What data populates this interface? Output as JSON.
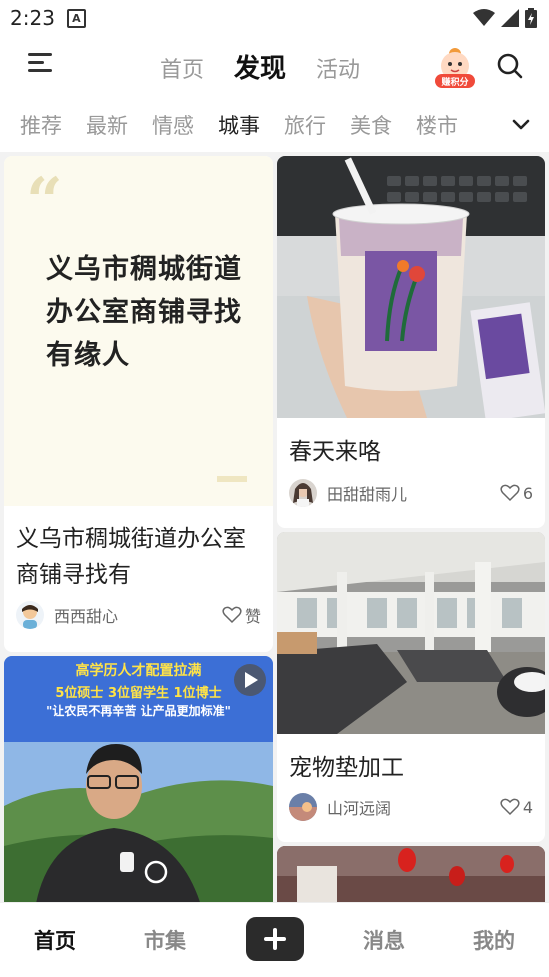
{
  "status_bar": {
    "time": "2:23",
    "badge": "A"
  },
  "header": {
    "tabs": [
      {
        "label": "首页",
        "active": false
      },
      {
        "label": "发现",
        "active": true
      },
      {
        "label": "活动",
        "active": false
      }
    ],
    "points_label": "赚积分"
  },
  "categories": {
    "items": [
      "推荐",
      "最新",
      "情感",
      "城事",
      "旅行",
      "美食",
      "楼市"
    ],
    "active": "城事"
  },
  "feed": {
    "card1": {
      "quote": "义乌市稠城街道办公室商铺寻找有缘人",
      "title": "义乌市稠城街道办公室商铺寻找有",
      "author": "西西甜心",
      "likes": "赞"
    },
    "card2": {
      "title": "春天来咯",
      "author": "田甜甜雨儿",
      "likes": "6"
    },
    "card3": {
      "title": "宠物垫加工",
      "author": "山河远阔",
      "likes": "4"
    },
    "video_card": {
      "headline": "高学历人才配置拉满",
      "subline": "5位硕士 3位留学生 1位博士",
      "slogan": "\"让农民不再辛苦 让产品更加标准\""
    }
  },
  "bottom_nav": {
    "items": [
      {
        "label": "首页",
        "active": true
      },
      {
        "label": "市集",
        "active": false
      },
      {
        "label": "消息",
        "active": false
      },
      {
        "label": "我的",
        "active": false
      }
    ]
  }
}
